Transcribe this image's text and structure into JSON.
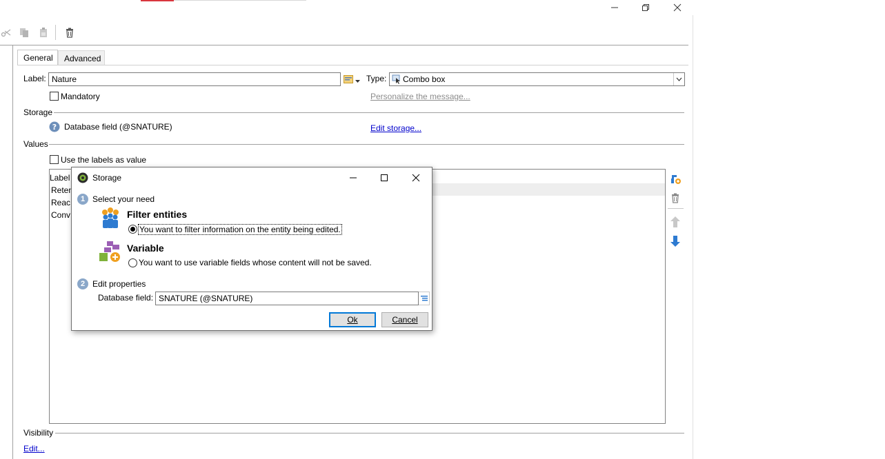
{
  "window": {
    "minimize_icon": "minimize-icon",
    "restore_icon": "restore-icon",
    "close_icon": "close-icon"
  },
  "toolbar": {
    "icons": [
      "cut-icon",
      "copy-icon",
      "paste-icon",
      "delete-icon"
    ]
  },
  "tabs": [
    {
      "label": "General",
      "active": true
    },
    {
      "label": "Advanced",
      "active": false
    }
  ],
  "form": {
    "label_caption": "Label:",
    "label_value": "Nature",
    "type_caption": "Type:",
    "type_value": "Combo box",
    "mandatory_label": "Mandatory",
    "personalize_link": "Personalize the message...",
    "storage_section": "Storage",
    "storage_value": "Database field (@SNATURE)",
    "edit_storage_link": "Edit storage...",
    "values_section": "Values",
    "use_labels_checkbox": "Use the labels as value",
    "list_header": "Label",
    "list_rows": [
      "Reten",
      "Reac",
      "Conv"
    ],
    "visibility_section": "Visibility",
    "visibility_edit_link": "Edit..."
  },
  "dialog": {
    "title": "Storage",
    "step1_number": "1",
    "step1_label": "Select your need",
    "option1_title": "Filter entities",
    "option1_desc": "You want to filter information on the entity being edited.",
    "option1_selected": true,
    "option2_title": "Variable",
    "option2_desc": "You want to use variable fields whose content will not be saved.",
    "step2_number": "2",
    "step2_label": "Edit properties",
    "db_field_caption": "Database field:",
    "db_field_value": "SNATURE (@SNATURE)",
    "ok_button": "Ok",
    "cancel_button": "Cancel"
  },
  "colors": {
    "accent": "#0078d7",
    "link": "#0000cc",
    "step_badge": "#8aa7c9"
  }
}
